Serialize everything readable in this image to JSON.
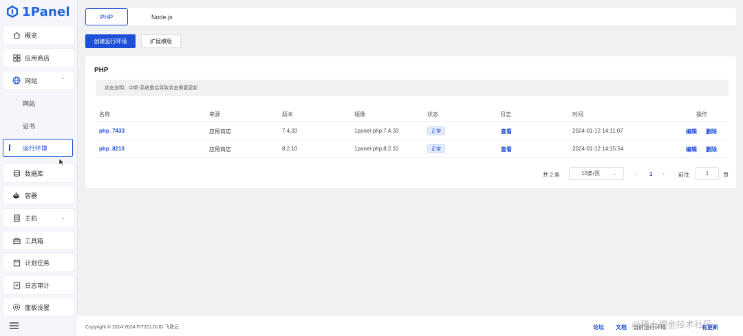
{
  "brand": {
    "name": "1Panel",
    "color": "#1d63d8"
  },
  "sidebar": {
    "items": [
      {
        "label": "概览",
        "icon": "home-icon"
      },
      {
        "label": "应用商店",
        "icon": "grid-icon"
      },
      {
        "label": "网站",
        "icon": "globe-icon",
        "expanded": true
      },
      {
        "label": "网站",
        "sub": true
      },
      {
        "label": "证书",
        "sub": true
      },
      {
        "label": "运行环境",
        "sub": true,
        "active": true
      },
      {
        "label": "数据库",
        "icon": "database-icon"
      },
      {
        "label": "容器",
        "icon": "docker-icon"
      },
      {
        "label": "主机",
        "icon": "server-icon",
        "expandable": true
      },
      {
        "label": "工具箱",
        "icon": "toolbox-icon"
      },
      {
        "label": "计划任务",
        "icon": "calendar-icon"
      },
      {
        "label": "日志审计",
        "icon": "log-icon"
      },
      {
        "label": "面板设置",
        "icon": "settings-icon"
      }
    ]
  },
  "tabs": [
    {
      "label": "PHP",
      "active": true
    },
    {
      "label": "Node.js",
      "active": false
    }
  ],
  "actions": {
    "create_label": "创建运行环境",
    "extensions_label": "扩展模版"
  },
  "card": {
    "title": "PHP",
    "notice": "状态说明：中断-系统重启导致状态需要更新"
  },
  "table": {
    "columns": [
      "名称",
      "来源",
      "版本",
      "镜像",
      "状态",
      "日志",
      "时间",
      "操作"
    ],
    "rows": [
      {
        "name": "php_7433",
        "source": "应用商店",
        "version": "7.4.33",
        "image": "1panel-php:7.4.33",
        "status": "正常",
        "log": "查看",
        "time": "2024-01-12 14:11:07",
        "edit": "编辑",
        "delete": "删除"
      },
      {
        "name": "php_8210",
        "source": "应用商店",
        "version": "8.2.10",
        "image": "1panel-php:8.2.10",
        "status": "正常",
        "log": "查看",
        "time": "2024-01-12 14:15:54",
        "edit": "编辑",
        "delete": "删除"
      }
    ]
  },
  "pagination": {
    "total_text": "共 2 条",
    "page_size": "10条/页",
    "current_page": "1",
    "goto_label": "前往",
    "goto_value": "1",
    "goto_unit": "页"
  },
  "footer": {
    "copyright": "Copyright © 2014-2024 FIT2CLOUD 飞致云",
    "links": [
      "论坛",
      "文档",
      "当前运行环境",
      "有更新"
    ]
  },
  "watermark": "@稀土掘金技术社区"
}
